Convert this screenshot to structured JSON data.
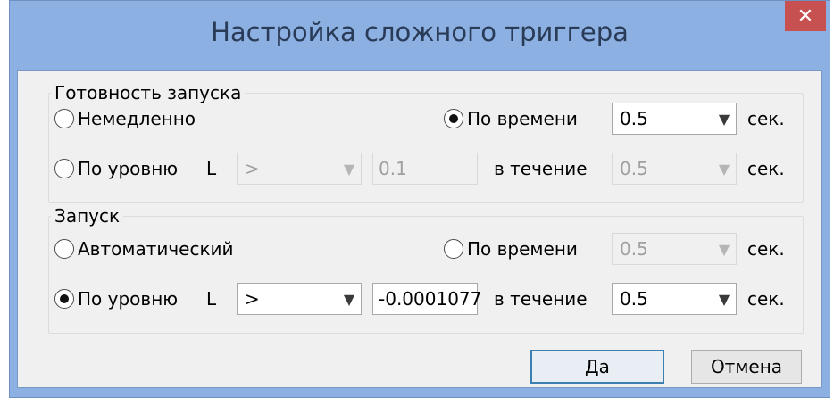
{
  "window": {
    "title": "Настройка сложного триггера",
    "close_glyph": "✕"
  },
  "readiness": {
    "title": "Готовность запуска",
    "immediately": {
      "label": "Немедленно",
      "checked": false
    },
    "by_time": {
      "label": "По времени",
      "checked": true,
      "value": "0.5",
      "unit": "сек."
    },
    "by_level": {
      "label": "По уровню",
      "checked": false,
      "channel": "L",
      "condition": ">",
      "level": "0.1",
      "during_label": "в течение",
      "duration": "0.5",
      "unit": "сек."
    }
  },
  "trigger": {
    "title": "Запуск",
    "automatic": {
      "label": "Автоматический",
      "checked": false
    },
    "by_time": {
      "label": "По времени",
      "checked": false,
      "value": "0.5",
      "unit": "сек."
    },
    "by_level": {
      "label": "По уровню",
      "checked": true,
      "channel": "L",
      "condition": ">",
      "level": "-0.0001077",
      "during_label": "в течение",
      "duration": "0.5",
      "unit": "сек."
    }
  },
  "buttons": {
    "ok": "Да",
    "cancel": "Отмена"
  },
  "icons": {
    "dropdown": "chevron-down-icon"
  }
}
